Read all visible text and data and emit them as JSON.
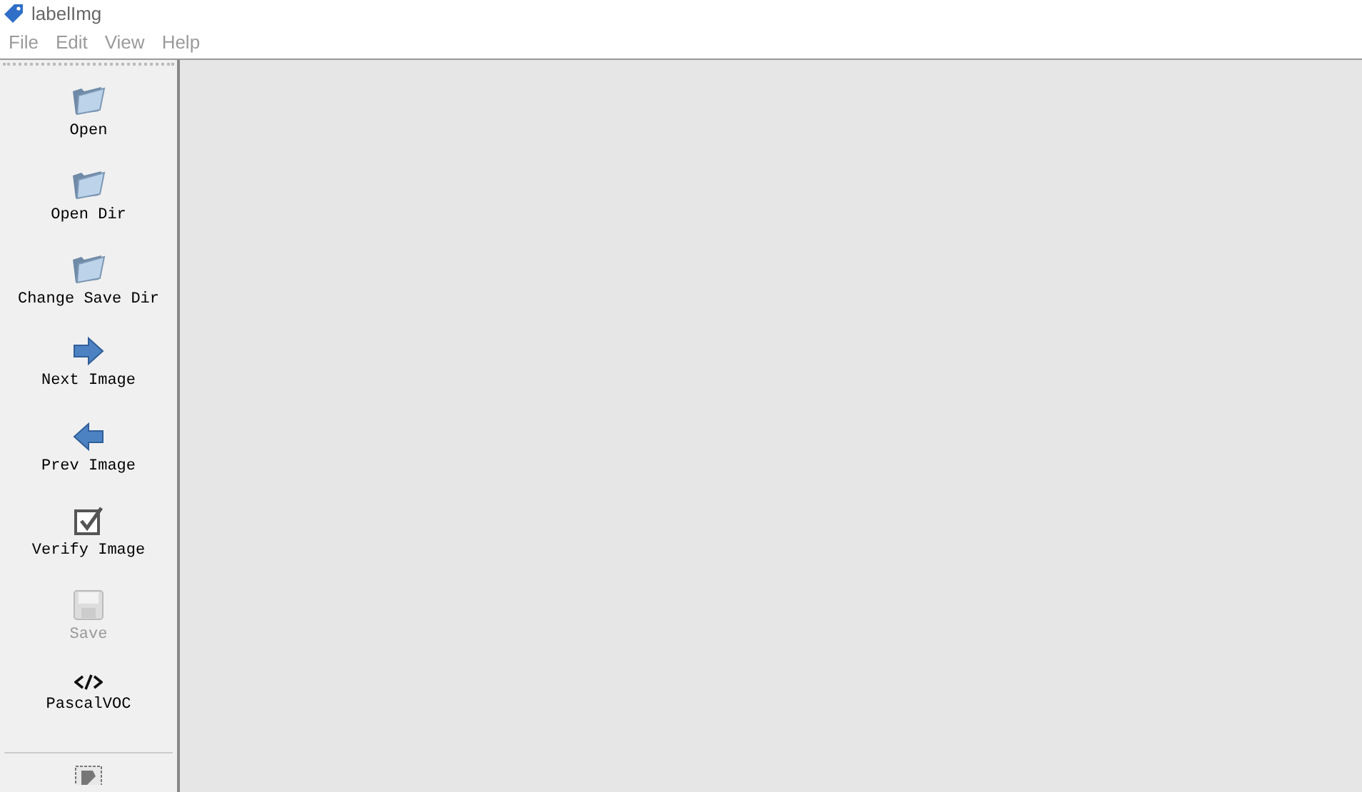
{
  "window": {
    "title": "labelImg"
  },
  "menu": [
    "File",
    "Edit",
    "View",
    "Help"
  ],
  "tools": [
    {
      "kind": "folder",
      "label": "Open",
      "disabled": false
    },
    {
      "kind": "folder",
      "label": "Open Dir",
      "disabled": false
    },
    {
      "kind": "folder",
      "label": "Change Save Dir",
      "disabled": false
    },
    {
      "kind": "next",
      "label": "Next Image",
      "disabled": false
    },
    {
      "kind": "prev",
      "label": "Prev Image",
      "disabled": false
    },
    {
      "kind": "verify",
      "label": "Verify Image",
      "disabled": false
    },
    {
      "kind": "save",
      "label": "Save",
      "disabled": true
    },
    {
      "kind": "code",
      "label": "PascalVOC",
      "disabled": false
    }
  ]
}
